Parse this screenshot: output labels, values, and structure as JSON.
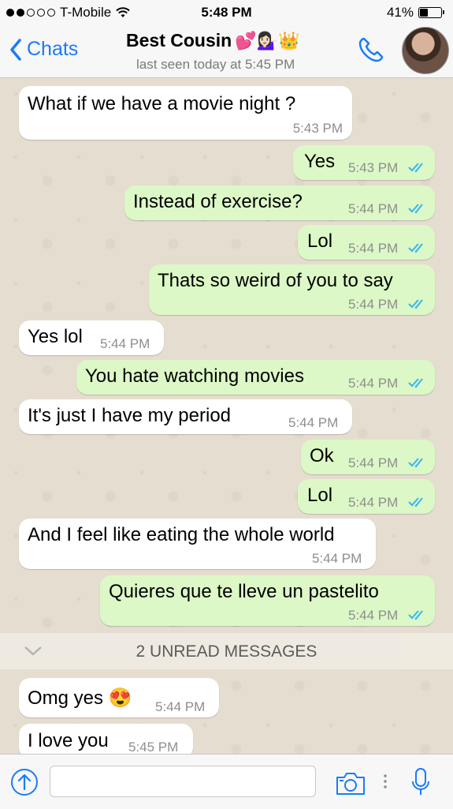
{
  "status": {
    "carrier": "T-Mobile",
    "time": "5:48 PM",
    "battery": "41%",
    "battery_level": 0.41,
    "signal_bars": 2
  },
  "nav": {
    "back_label": "Chats",
    "title": "Best Cousin",
    "title_emojis": "💕💁🏻‍♀️👑",
    "subtitle": "last seen today at 5:45 PM"
  },
  "messages": [
    {
      "dir": "in",
      "text": "What if we have a movie night ?",
      "time": "5:43 PM"
    },
    {
      "dir": "out",
      "text": "Yes",
      "time": "5:43 PM"
    },
    {
      "dir": "out",
      "text": "Instead of exercise?",
      "time": "5:44 PM"
    },
    {
      "dir": "out",
      "text": "Lol",
      "time": "5:44 PM"
    },
    {
      "dir": "out",
      "text": "Thats so weird of you to say",
      "time": "5:44 PM"
    },
    {
      "dir": "in",
      "text": "Yes lol",
      "time": "5:44 PM"
    },
    {
      "dir": "out",
      "text": "You hate watching movies",
      "time": "5:44 PM"
    },
    {
      "dir": "in",
      "text": "It's just I have my period",
      "time": "5:44 PM"
    },
    {
      "dir": "out",
      "text": "Ok",
      "time": "5:44 PM"
    },
    {
      "dir": "out",
      "text": "Lol",
      "time": "5:44 PM"
    },
    {
      "dir": "in",
      "text": "And I feel like eating the whole world",
      "time": "5:44 PM"
    },
    {
      "dir": "out",
      "text": "Quieres que te lleve un pastelito",
      "time": "5:44 PM"
    },
    {
      "dir": "in",
      "text": "Omg yes 😍",
      "time": "5:44 PM"
    },
    {
      "dir": "in",
      "text": "I love you",
      "time": "5:45 PM"
    }
  ],
  "unread_label": "2 UNREAD MESSAGES",
  "input": {
    "value": "",
    "placeholder": ""
  },
  "colors": {
    "accent": "#1a7cf7",
    "outgoing": "#dcf8c6",
    "incoming": "#ffffff",
    "read_ticks": "#34b7f1"
  }
}
